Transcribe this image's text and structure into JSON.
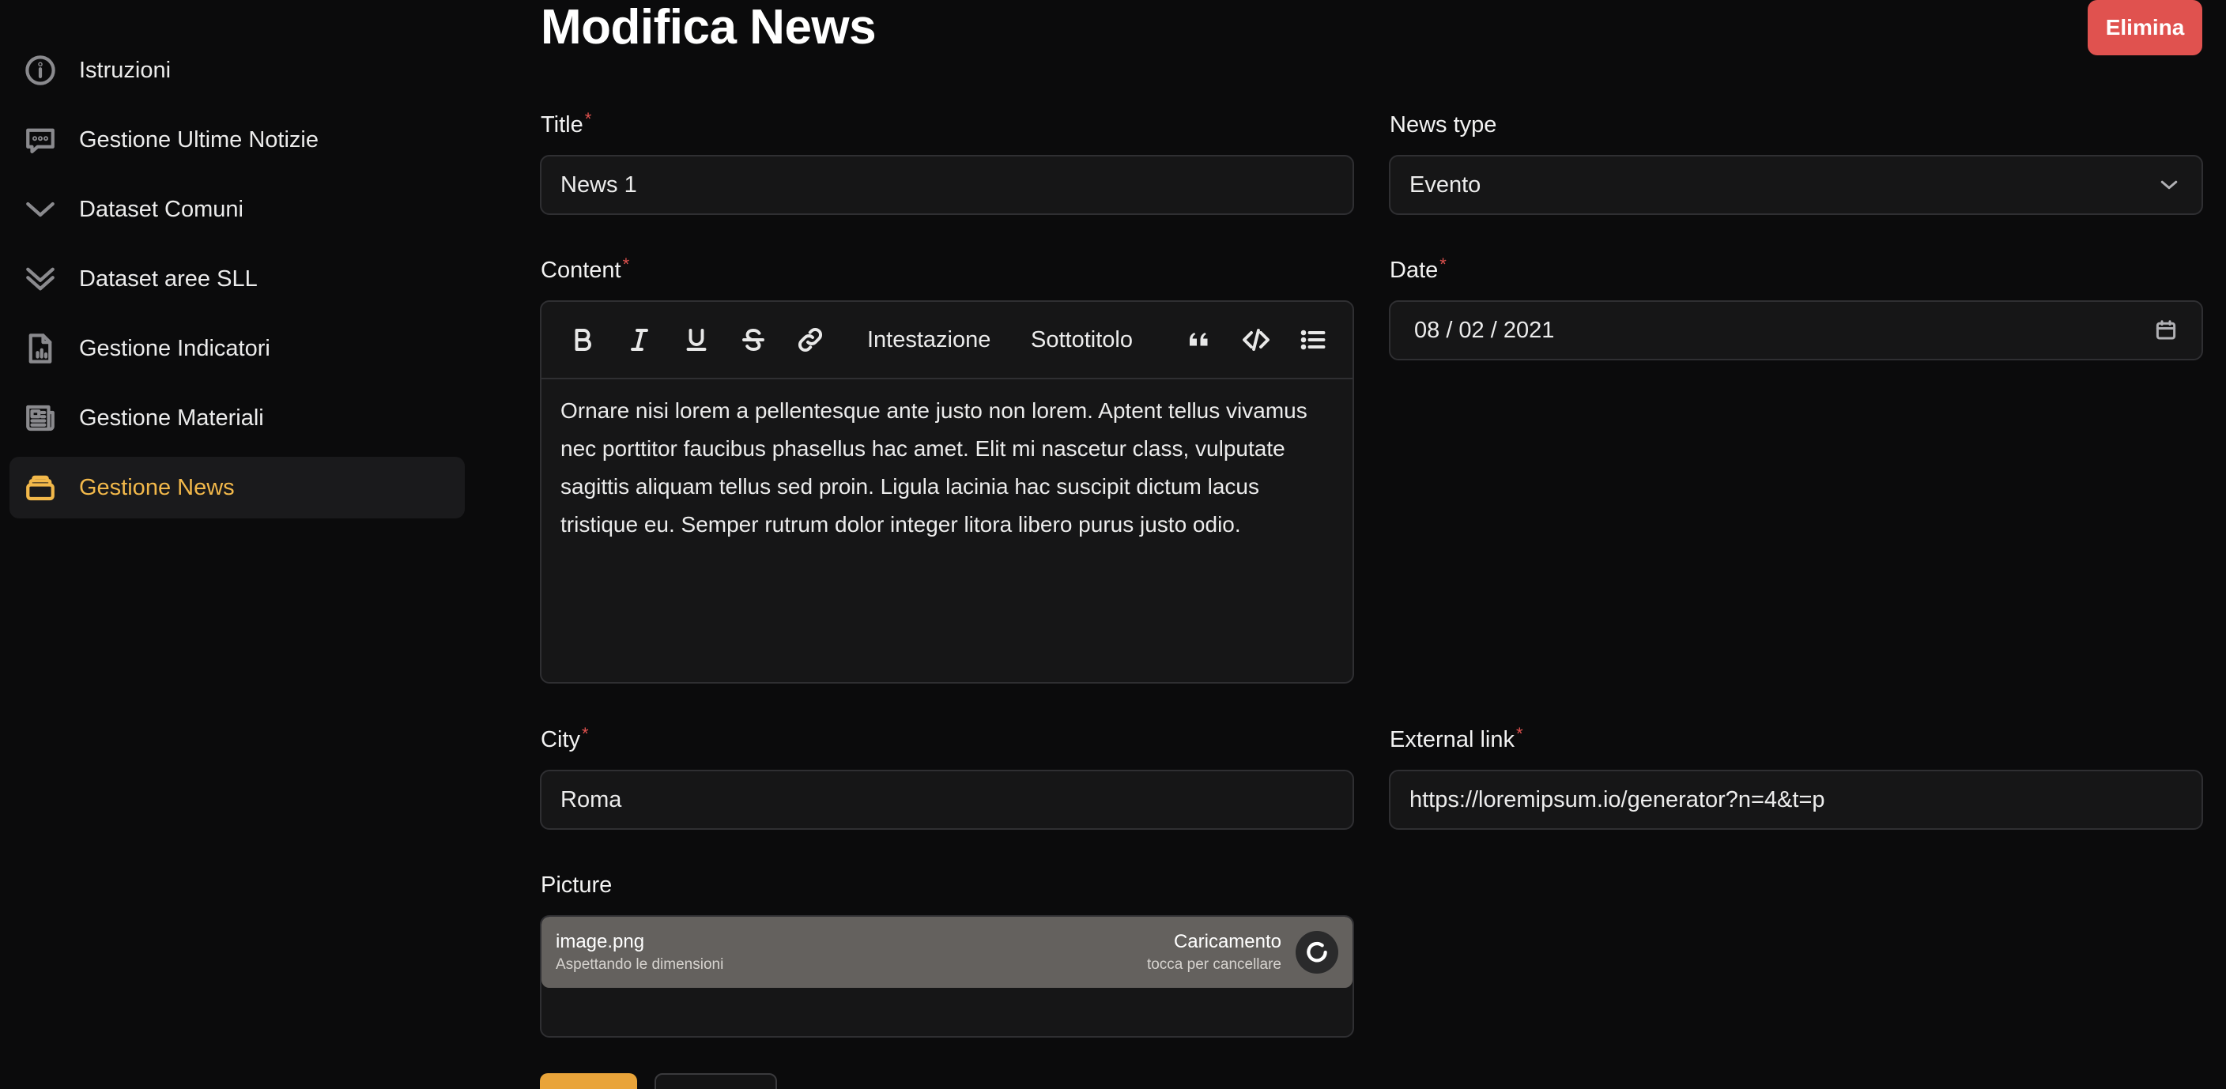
{
  "sidebar": {
    "items": [
      {
        "label": "Istruzioni",
        "icon": "info-icon"
      },
      {
        "label": "Gestione Ultime Notizie",
        "icon": "chat-bubble-icon"
      },
      {
        "label": "Dataset Comuni",
        "icon": "chevron-down-icon"
      },
      {
        "label": "Dataset aree SLL",
        "icon": "double-chevron-down-icon"
      },
      {
        "label": "Gestione Indicatori",
        "icon": "document-chart-icon"
      },
      {
        "label": "Gestione Materiali",
        "icon": "newspaper-icon"
      },
      {
        "label": "Gestione News",
        "icon": "stack-icon",
        "active": true
      }
    ]
  },
  "header": {
    "title": "Modifica News",
    "delete_label": "Elimina"
  },
  "form": {
    "title": {
      "label": "Title",
      "required_mark": "*",
      "value": "News 1"
    },
    "news_type": {
      "label": "News type",
      "value": "Evento"
    },
    "content": {
      "label": "Content",
      "required_mark": "*",
      "toolbar": {
        "heading": "Intestazione",
        "subheading": "Sottotitolo"
      },
      "value": "Ornare nisi lorem a pellentesque ante justo non lorem. Aptent tellus vivamus nec porttitor faucibus phasellus hac amet. Elit mi nascetur class, vulputate sagittis aliquam tellus sed proin. Ligula lacinia hac suscipit dictum lacus tristique eu. Semper rutrum dolor integer litora libero purus justo odio."
    },
    "date": {
      "label": "Date",
      "required_mark": "*",
      "value": "08 / 02 / 2021"
    },
    "city": {
      "label": "City",
      "required_mark": "*",
      "value": "Roma"
    },
    "external_link": {
      "label": "External link",
      "required_mark": "*",
      "value": "https://loremipsum.io/generator?n=4&t=p"
    },
    "picture": {
      "label": "Picture",
      "file_name": "image.png",
      "file_status": "Aspettando le dimensioni",
      "upload_status": "Caricamento",
      "upload_hint": "tocca per cancellare"
    }
  },
  "colors": {
    "accent": "#f2b84a",
    "danger": "#e0524f",
    "background": "#0b0b0c",
    "field_bg": "#161617"
  }
}
